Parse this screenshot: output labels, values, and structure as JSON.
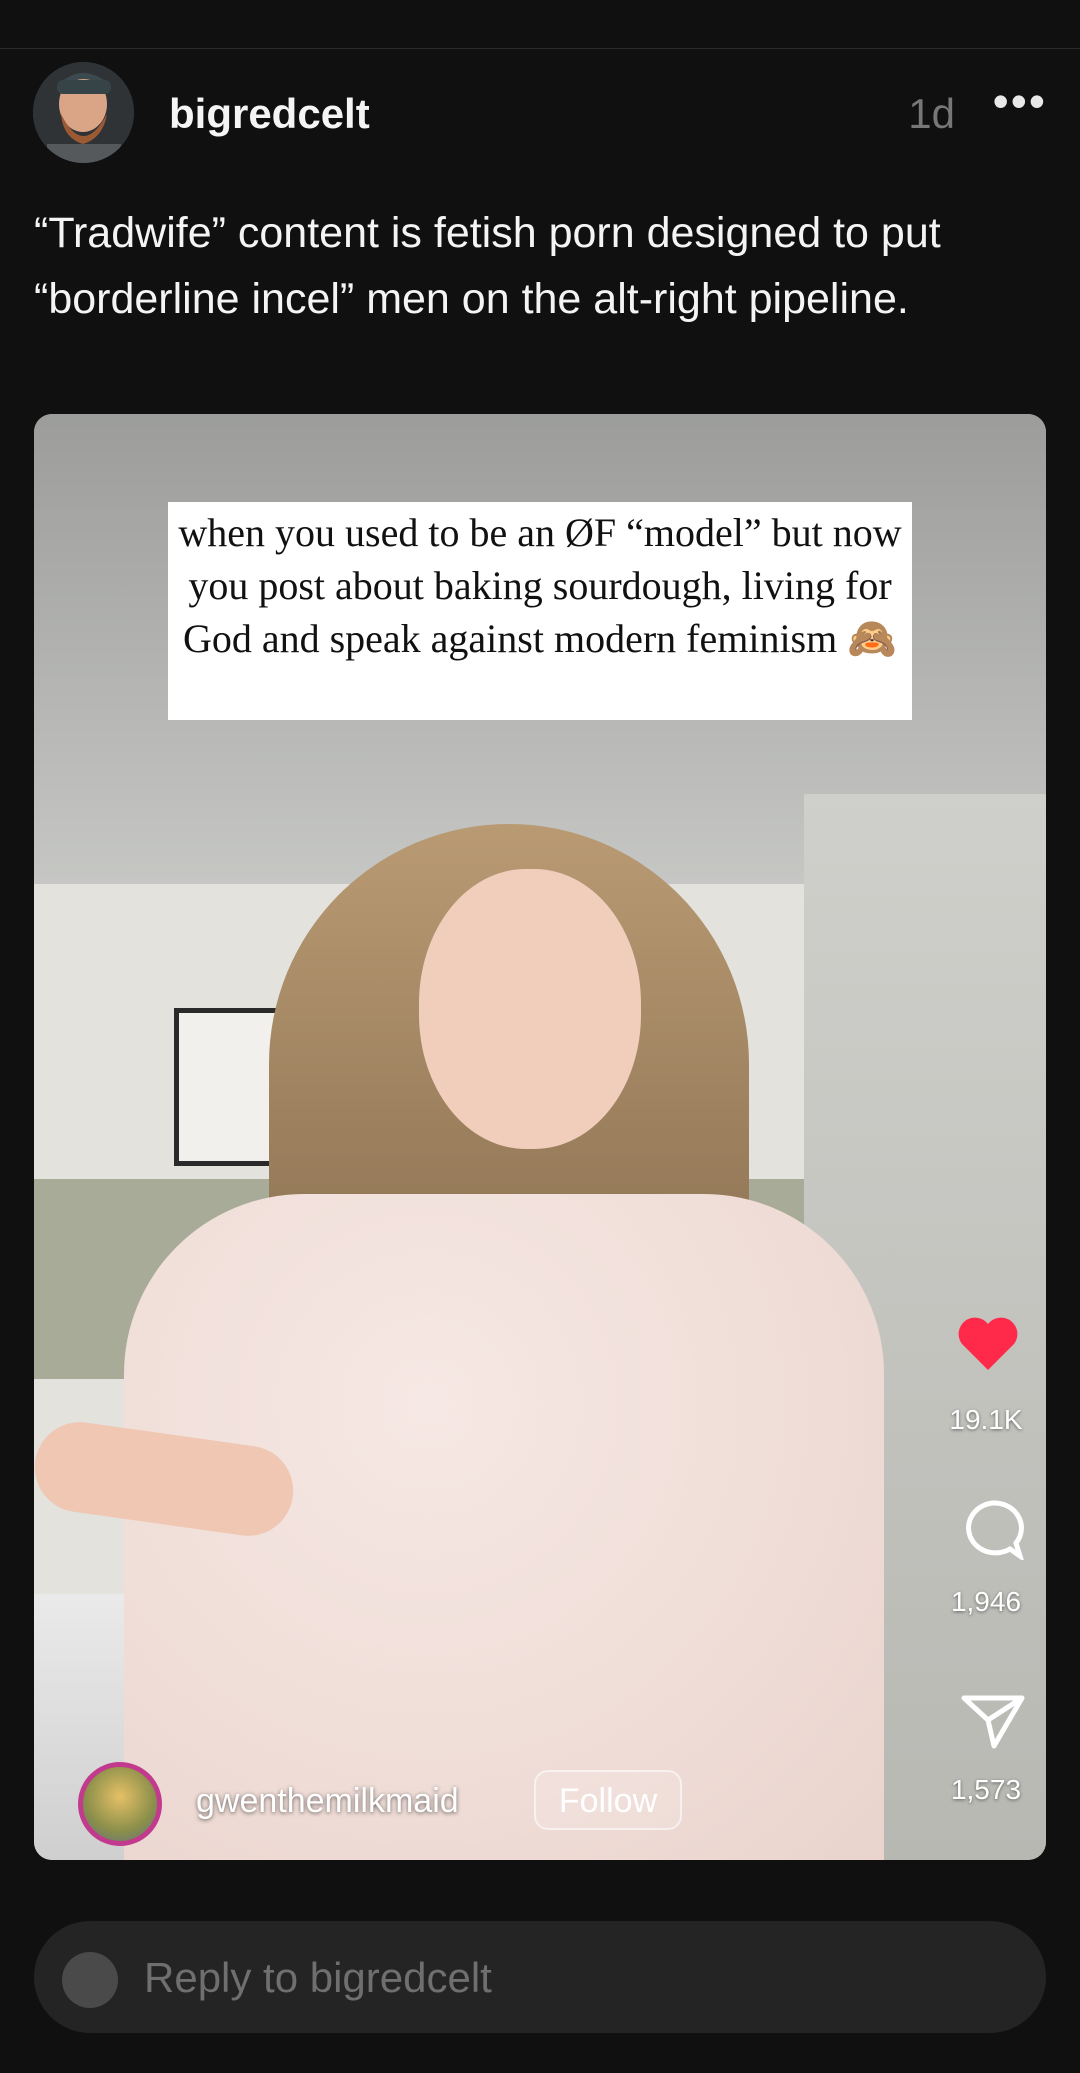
{
  "post": {
    "username": "bigredcelt",
    "time": "1d",
    "more_label": "•••",
    "text": "“Tradwife” content is fetish porn designed to put “borderline incel” men on the alt-right pipeline."
  },
  "media": {
    "caption": "when you used to be an ØF “model” but now you post about baking sourdough, living for God and speak against modern feminism 🙈",
    "creator": "gwenthemilkmaid",
    "follow_label": "Follow",
    "likes": "19.1K",
    "comments": "1,946",
    "shares": "1,573",
    "icons": {
      "like": "heart-icon",
      "comment": "comment-icon",
      "share": "share-icon"
    },
    "colors": {
      "heart": "#ff2a4a",
      "creator_ring": "#c23a8e"
    }
  },
  "reply": {
    "placeholder": "Reply to bigredcelt"
  }
}
